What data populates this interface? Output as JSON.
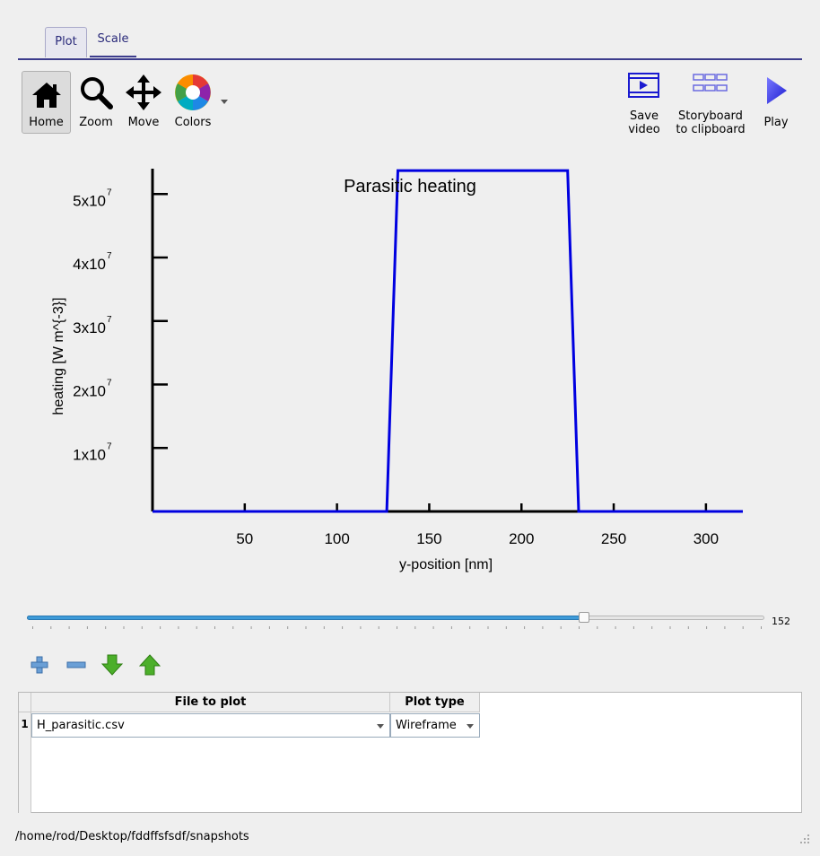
{
  "tabs": [
    {
      "label": "Plot",
      "active": true
    },
    {
      "label": "Scale",
      "active": false
    }
  ],
  "toolbar": {
    "home_label": "Home",
    "zoom_label": "Zoom",
    "move_label": "Move",
    "colors_label": "Colors",
    "save_video_line1": "Save",
    "save_video_line2": "video",
    "storyboard_line1": "Storyboard",
    "storyboard_line2": "to clipboard",
    "play_label": "Play"
  },
  "chart_data": {
    "type": "line",
    "title": "Parasitic heating",
    "xlabel": "y-position [nm]",
    "ylabel": "heating [W m^{-3}]",
    "xlim": [
      0,
      320
    ],
    "ylim": [
      0,
      54000000
    ],
    "x_ticks": [
      50,
      100,
      150,
      200,
      250,
      300
    ],
    "y_ticks": [
      {
        "mantissa": "1x10",
        "exp": "7",
        "value": 10000000
      },
      {
        "mantissa": "2x10",
        "exp": "7",
        "value": 20000000
      },
      {
        "mantissa": "3x10",
        "exp": "7",
        "value": 30000000
      },
      {
        "mantissa": "4x10",
        "exp": "7",
        "value": 40000000
      },
      {
        "mantissa": "5x10",
        "exp": "7",
        "value": 50000000
      }
    ],
    "series": [
      {
        "color": "#0000e0",
        "x": [
          0,
          127,
          130,
          133,
          225,
          228,
          231,
          320
        ],
        "y": [
          0,
          0,
          27000000,
          53700000,
          53700000,
          27000000,
          0,
          0
        ]
      }
    ]
  },
  "slider": {
    "value": "152",
    "fraction": 0.756
  },
  "table": {
    "headers": [
      "File to plot",
      "Plot type"
    ],
    "rows": [
      {
        "num": "1",
        "file": "H_parasitic.csv",
        "type": "Wireframe"
      }
    ]
  },
  "status": {
    "path": "/home/rod/Desktop/fddffsfsdf/snapshots"
  },
  "colors": {
    "accent": "#3c3c8c",
    "series": "#0000e0",
    "slider": "#3d9ad8"
  }
}
